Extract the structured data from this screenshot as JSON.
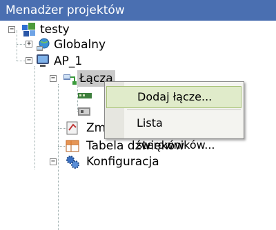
{
  "window": {
    "title": "Menadżer projektów"
  },
  "tree": {
    "root": {
      "label": "testy",
      "expander": "−",
      "icon": "project-icon"
    },
    "globalny": {
      "label": "Globalny",
      "expander": "+",
      "icon": "globe-icon"
    },
    "ap": {
      "label": "AP_1",
      "expander": "−",
      "icon": "monitor-icon"
    },
    "lacza": {
      "label": "Łącza",
      "expander": "−",
      "icon": "network-connections-icon"
    },
    "zm": {
      "label": "Zm",
      "icon": "variables-icon"
    },
    "tabela": {
      "label": "Tabela dźwięków",
      "icon": "sound-table-icon"
    },
    "konfiguracja": {
      "label": "Konfiguracja",
      "expander": "−",
      "icon": "gears-icon"
    }
  },
  "context_menu": {
    "items": [
      {
        "label": "Dodaj łącze..."
      },
      {
        "label": "Lista sterowników..."
      }
    ]
  },
  "colors": {
    "titlebar": "#4a6fb1",
    "menu_highlight": "#e0ebca"
  }
}
